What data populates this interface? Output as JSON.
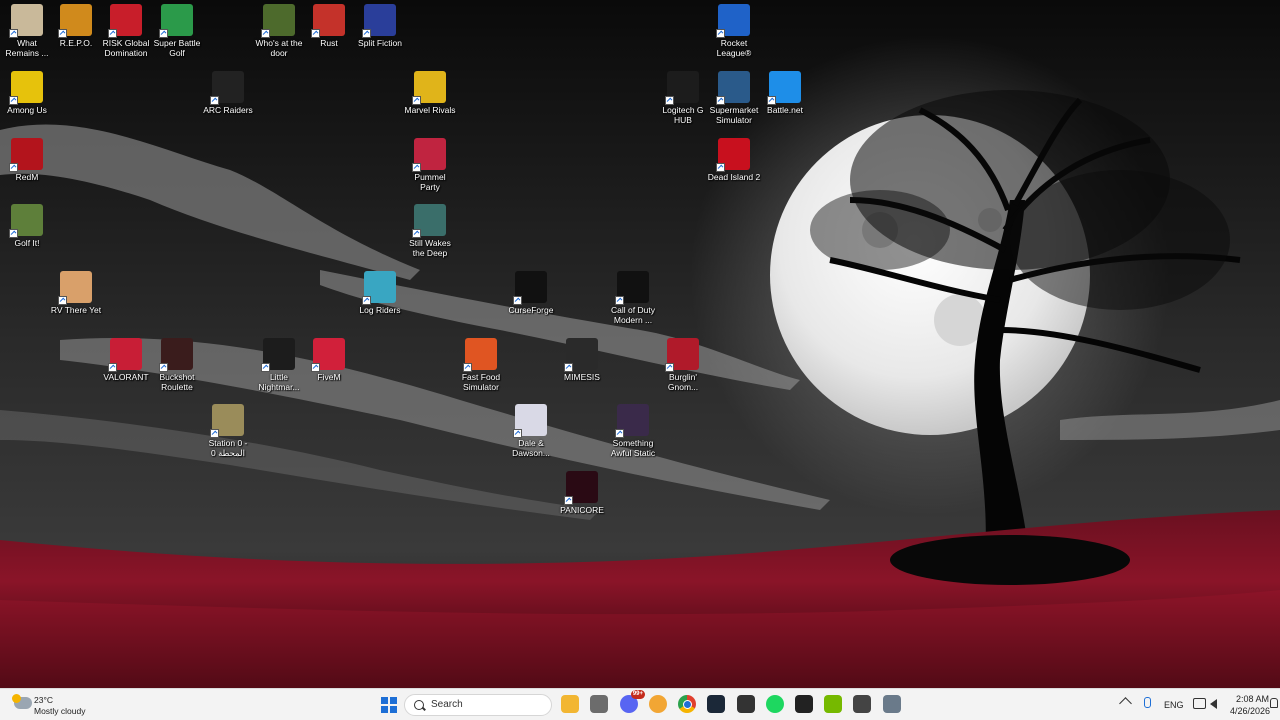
{
  "desktop": {
    "icons": [
      {
        "id": "what-remains",
        "label": "What\nRemains ...",
        "color": "#c9b99a"
      },
      {
        "id": "repo",
        "label": "R.E.P.O.",
        "color": "#d08a1c"
      },
      {
        "id": "risk",
        "label": "RISK Global\nDomination",
        "color": "#c81e2a"
      },
      {
        "id": "super-battle-golf",
        "label": "Super Battle\nGolf",
        "color": "#2b9a4a"
      },
      {
        "id": "whos-at-the-door",
        "label": "Who's at the\ndoor",
        "color": "#4d6a2c"
      },
      {
        "id": "rust",
        "label": "Rust",
        "color": "#c4322a"
      },
      {
        "id": "split-fiction",
        "label": "Split Fiction",
        "color": "#2a3e9a"
      },
      {
        "id": "rocket-league",
        "label": "Rocket\nLeague®",
        "color": "#1f62c8"
      },
      {
        "id": "among-us",
        "label": "Among Us",
        "color": "#e6c20c"
      },
      {
        "id": "arc-raiders",
        "label": "ARC Raiders",
        "color": "#222222"
      },
      {
        "id": "marvel-rivals",
        "label": "Marvel Rivals",
        "color": "#e0b41a"
      },
      {
        "id": "logitech",
        "label": "Logitech G\nHUB",
        "color": "#1c1c1c"
      },
      {
        "id": "supermarket",
        "label": "Supermarket\nSimulator",
        "color": "#2a5a8a"
      },
      {
        "id": "battlenet",
        "label": "Battle.net",
        "color": "#1e8ee8"
      },
      {
        "id": "redm",
        "label": "RedM",
        "color": "#b3141c"
      },
      {
        "id": "pummel-party",
        "label": "Pummel\nParty",
        "color": "#c02440"
      },
      {
        "id": "dead-island",
        "label": "Dead Island 2",
        "color": "#c8101e"
      },
      {
        "id": "golf-it",
        "label": "Golf It!",
        "color": "#5e7f3a"
      },
      {
        "id": "still-wakes",
        "label": "Still Wakes\nthe Deep",
        "color": "#3a6e6a"
      },
      {
        "id": "rv-there-yet",
        "label": "RV There Yet",
        "color": "#d9a06a"
      },
      {
        "id": "log-riders",
        "label": "Log Riders",
        "color": "#39a6c2"
      },
      {
        "id": "curseforge",
        "label": "CurseForge",
        "color": "#111111"
      },
      {
        "id": "cod",
        "label": "Call of Duty\nModern ...",
        "color": "#111111"
      },
      {
        "id": "valorant",
        "label": "VALORANT",
        "color": "#c81e36"
      },
      {
        "id": "buckshot",
        "label": "Buckshot\nRoulette",
        "color": "#3a1c1c"
      },
      {
        "id": "little-nightmares",
        "label": "Little\nNightmar...",
        "color": "#1c1c1c"
      },
      {
        "id": "fivem",
        "label": "FiveM",
        "color": "#d1203a"
      },
      {
        "id": "fast-food",
        "label": "Fast Food\nSimulator",
        "color": "#e05522"
      },
      {
        "id": "mimesis",
        "label": "MIMESIS",
        "color": "#2a2a2a"
      },
      {
        "id": "burglin",
        "label": "Burglin'\nGnom...",
        "color": "#b01a2a"
      },
      {
        "id": "station-0",
        "label": "Station 0 -\nالمحطة 0",
        "color": "#9a8c5a"
      },
      {
        "id": "dale-dawson",
        "label": "Dale &\nDawson...",
        "color": "#d9d9e6"
      },
      {
        "id": "something-awful",
        "label": "Something\nAwful Static",
        "color": "#3a2a4a"
      },
      {
        "id": "panicore",
        "label": "PANICORE",
        "color": "#2a0a14"
      }
    ]
  },
  "taskbar": {
    "weather": {
      "temp": "23°C",
      "condition": "Mostly cloudy"
    },
    "search": {
      "placeholder": "Search"
    },
    "apps": [
      {
        "id": "file-explorer",
        "color": "#f2b632"
      },
      {
        "id": "microsoft-store",
        "color": "#6c6c6c"
      },
      {
        "id": "discord",
        "color": "#5865f2",
        "badge": "99+"
      },
      {
        "id": "discord-ptb",
        "color": "#f2a634"
      },
      {
        "id": "chrome",
        "color": "#e0402e"
      },
      {
        "id": "steam",
        "color": "#1b2838"
      },
      {
        "id": "settings-gear",
        "color": "#333333"
      },
      {
        "id": "spotify",
        "color": "#1ed760"
      },
      {
        "id": "game-app",
        "color": "#222222"
      },
      {
        "id": "nvidia",
        "color": "#76b900"
      },
      {
        "id": "recorder",
        "color": "#444444"
      },
      {
        "id": "system-settings",
        "color": "#6a7a8a"
      }
    ],
    "tray": {
      "language": "ENG",
      "time": "2:08 AM",
      "date": "4/26/2026"
    }
  }
}
